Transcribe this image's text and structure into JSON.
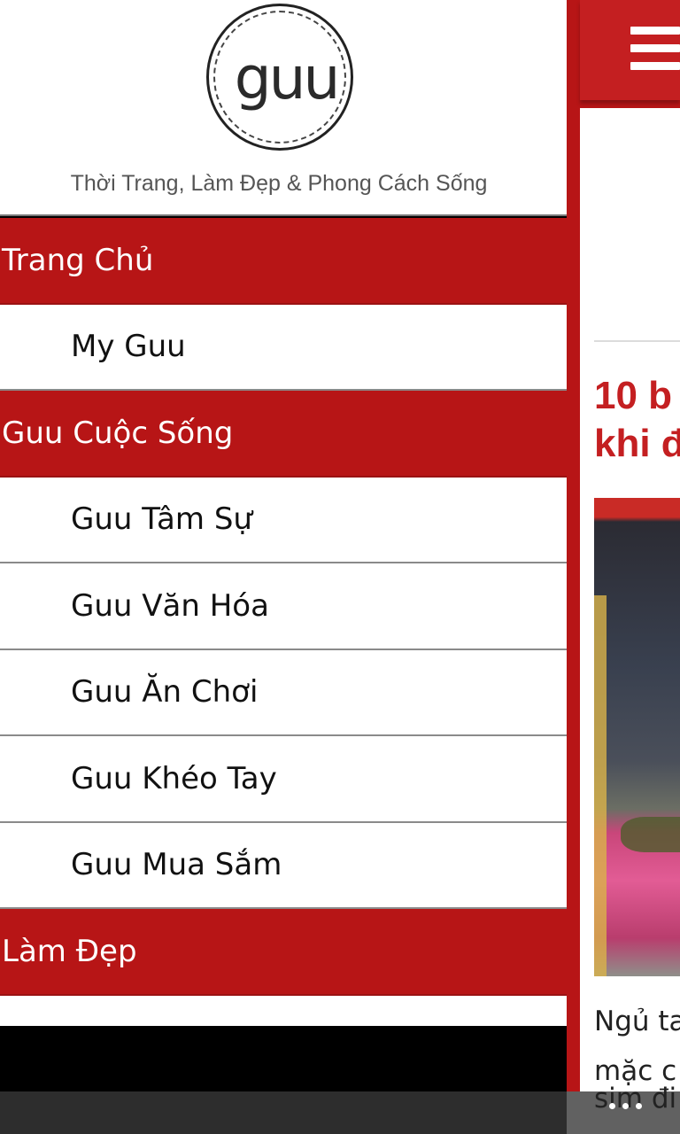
{
  "drawer": {
    "logo_text": "guu",
    "tagline": "Thời Trang, Làm Đẹp & Phong Cách Sống",
    "items": [
      {
        "label": "Trang Chủ"
      },
      {
        "label": "My Guu"
      },
      {
        "label": "Guu Cuộc Sống"
      },
      {
        "label": "Guu Tâm Sự"
      },
      {
        "label": "Guu Văn Hóa"
      },
      {
        "label": "Guu Ăn Chơi"
      },
      {
        "label": "Guu Khéo Tay"
      },
      {
        "label": "Guu Mua Sắm"
      },
      {
        "label": "Làm Đẹp"
      }
    ]
  },
  "content": {
    "article_title": "10 b\nkhi đ",
    "article_excerpt": "Ngủ ta\nmặc c",
    "article_excerpt_line3": "sim đi"
  },
  "icons": {
    "menu": "hamburger-icon",
    "more": "more-dots-icon"
  },
  "colors": {
    "brand_red": "#b71516",
    "title_red": "#c41f21",
    "app_bar": "#2d2d2d"
  }
}
